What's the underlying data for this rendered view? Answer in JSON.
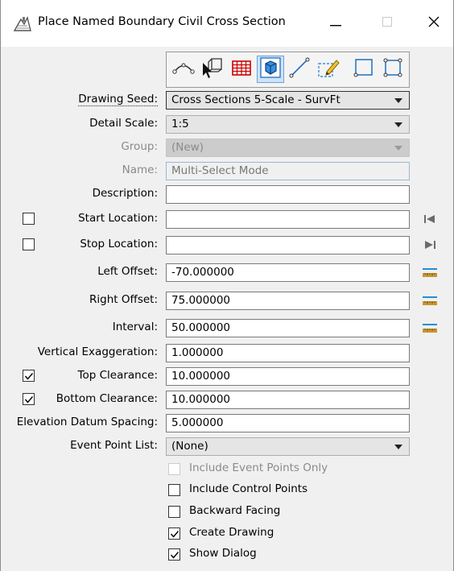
{
  "window": {
    "title": "Place Named Boundary Civil Cross Section",
    "icon": "civil-cross-section-icon",
    "controls": {
      "minimize": "minimize-icon",
      "maximize": "maximize-icon",
      "close": "close-icon"
    }
  },
  "toolbar": {
    "tools": [
      {
        "icon": "path-curve-icon",
        "selected": false
      },
      {
        "icon": "select-element-icon",
        "selected": false
      },
      {
        "icon": "grid-table-icon",
        "selected": false
      },
      {
        "icon": "cube-3d-icon",
        "selected": true
      },
      {
        "icon": "line-icon",
        "selected": false
      },
      {
        "icon": "edit-pencil-icon",
        "selected": false
      },
      {
        "icon": "rectangle-icon",
        "selected": false
      },
      {
        "icon": "shape-corners-icon",
        "selected": false
      }
    ]
  },
  "form": {
    "drawing_seed": {
      "label": "Drawing Seed:",
      "value": "Cross Sections 5-Scale - SurvFt"
    },
    "detail_scale": {
      "label": "Detail Scale:",
      "value": "1:5"
    },
    "group": {
      "label": "Group:",
      "value": "(New)"
    },
    "name": {
      "label": "Name:",
      "value": "Multi-Select Mode"
    },
    "description": {
      "label": "Description:",
      "value": ""
    },
    "start_location": {
      "label": "Start Location:",
      "value": "",
      "checked": false
    },
    "stop_location": {
      "label": "Stop Location:",
      "value": "",
      "checked": false
    },
    "left_offset": {
      "label": "Left Offset:",
      "value": "-70.000000"
    },
    "right_offset": {
      "label": "Right Offset:",
      "value": "75.000000"
    },
    "interval": {
      "label": "Interval:",
      "value": "50.000000"
    },
    "vertical_exaggeration": {
      "label": "Vertical Exaggeration:",
      "value": "1.000000"
    },
    "top_clearance": {
      "label": "Top Clearance:",
      "value": "10.000000",
      "checked": true
    },
    "bottom_clearance": {
      "label": "Bottom Clearance:",
      "value": "10.000000",
      "checked": true
    },
    "elevation_datum_spacing": {
      "label": "Elevation Datum Spacing:",
      "value": "5.000000"
    },
    "event_point_list": {
      "label": "Event Point List:",
      "value": "(None)"
    }
  },
  "options": [
    {
      "label": "Include Event Points Only",
      "checked": false,
      "enabled": false
    },
    {
      "label": "Include Control Points",
      "checked": false,
      "enabled": true
    },
    {
      "label": "Backward Facing",
      "checked": false,
      "enabled": true
    },
    {
      "label": "Create Drawing",
      "checked": true,
      "enabled": true
    },
    {
      "label": "Show Dialog",
      "checked": true,
      "enabled": true
    }
  ],
  "colors": {
    "selected_tool_bg": "#cfe3f7",
    "ruler_blue": "#1f8fd6",
    "ruler_tan": "#c89632",
    "grid_red": "#cc0000"
  }
}
